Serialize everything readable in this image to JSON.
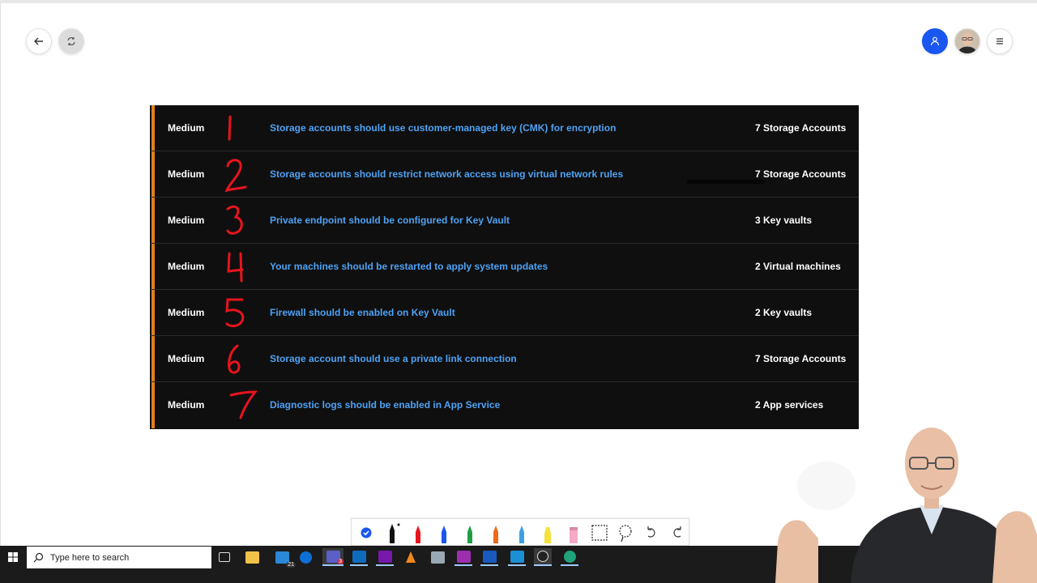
{
  "taskbar": {
    "search_placeholder": "Type here to search"
  },
  "recommendations": [
    {
      "severity": "Medium",
      "annotation": "1",
      "recommendation": "Storage accounts should use customer-managed key (CMK) for encryption",
      "resources": "7 Storage Accounts"
    },
    {
      "severity": "Medium",
      "annotation": "2",
      "recommendation": "Storage accounts should restrict network access using virtual network rules",
      "resources": "7 Storage Accounts"
    },
    {
      "severity": "Medium",
      "annotation": "3",
      "recommendation": "Private endpoint should be configured for Key Vault",
      "resources": "3 Key vaults"
    },
    {
      "severity": "Medium",
      "annotation": "4",
      "recommendation": "Your machines should be restarted to apply system updates",
      "resources": "2 Virtual machines"
    },
    {
      "severity": "Medium",
      "annotation": "5",
      "recommendation": "Firewall should be enabled on Key Vault",
      "resources": "2 Key vaults"
    },
    {
      "severity": "Medium",
      "annotation": "6",
      "recommendation": "Storage account should use a private link connection",
      "resources": "7 Storage Accounts"
    },
    {
      "severity": "Medium",
      "annotation": "7",
      "recommendation": "Diagnostic logs should be enabled in App Service",
      "resources": "2 App services"
    }
  ],
  "colors": {
    "severity_bar": "#e0801a",
    "link": "#4ea2f5",
    "ink": "#e8141c",
    "profile_button": "#1a56f0"
  },
  "icons": {
    "top_left": [
      "back-arrow-icon",
      "sync-icon"
    ],
    "top_right": [
      "person-icon",
      "avatar",
      "hamburger-menu-icon"
    ],
    "pen_toolbar": [
      "select-check-icon",
      "pen-black-icon",
      "pen-red-icon",
      "pen-blue-icon",
      "pen-green-icon",
      "pen-orange-icon",
      "pen-lightblue-icon",
      "highlighter-yellow-icon",
      "eraser-icon",
      "ruler-icon",
      "lasso-icon",
      "undo-icon",
      "redo-icon"
    ],
    "taskbar_apps": [
      "task-view-icon",
      "file-explorer-icon",
      "visual-studio-icon",
      "teamviewer-icon",
      "teams-icon",
      "outlook-icon",
      "onenote-icon",
      "vlc-icon",
      "remote-desktop-icon",
      "app-g-icon",
      "word-icon",
      "whiteboard-icon",
      "obs-icon",
      "edge-icon"
    ]
  },
  "taskbar_badges": {
    "visual_studio": "21",
    "teams": "3"
  }
}
